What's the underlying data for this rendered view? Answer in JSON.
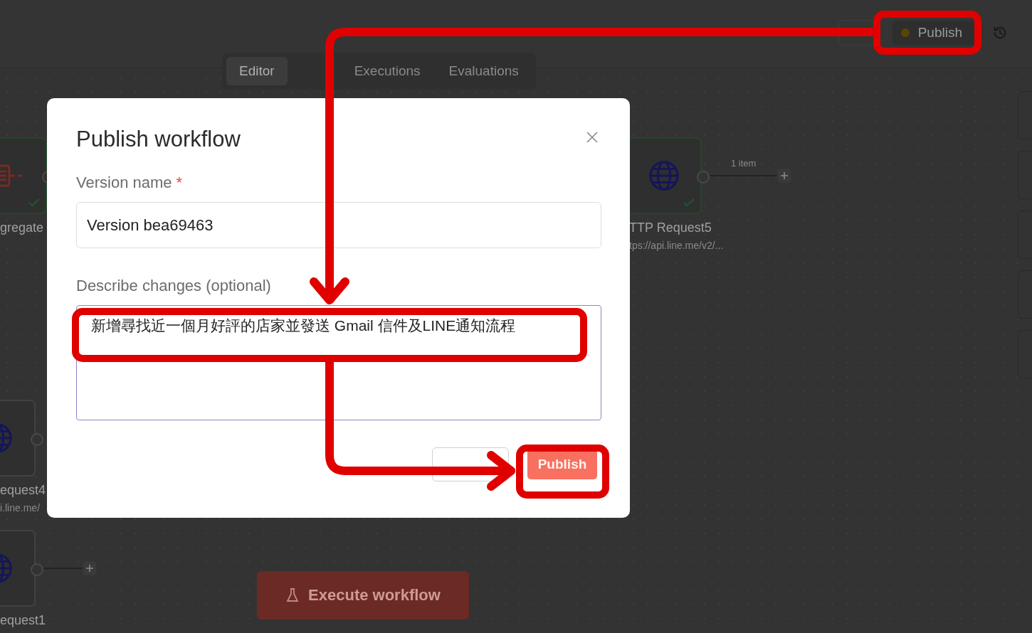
{
  "header": {
    "publish_button": {
      "label": "Publish"
    }
  },
  "tabs": [
    {
      "label": "Editor",
      "selected": true
    },
    {
      "label": "Executions",
      "selected": false
    },
    {
      "label": "Evaluations",
      "selected": false
    }
  ],
  "canvas": {
    "nodes": [
      {
        "kind": "aggregate",
        "name": "gregate",
        "done": true
      },
      {
        "kind": "http",
        "name": "TTP Request5",
        "subtitle": "tps://api.line.me/v2/...",
        "done": true
      },
      {
        "kind": "http",
        "name": "equest4",
        "subtitle": "i.line.me/",
        "done": false
      },
      {
        "kind": "http",
        "name": "equest1",
        "done": false
      }
    ],
    "connection_label": "1 item",
    "execute_button": {
      "label": "Execute workflow"
    }
  },
  "dialog": {
    "title": "Publish workflow",
    "version_label": "Version name",
    "required_mark": "*",
    "version_value": "Version bea69463",
    "changes_label": "Describe changes (optional)",
    "changes_value": "新增尋找近一個月好評的店家並發送 Gmail 信件及LINE通知流程",
    "publish_button": "Publish"
  }
}
